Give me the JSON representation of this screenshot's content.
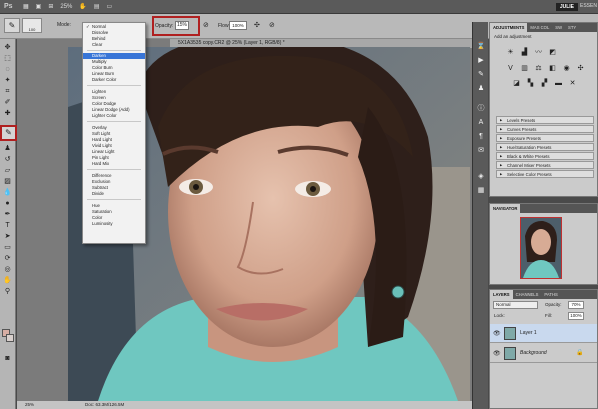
{
  "appbar": {
    "app_icon": "Ps",
    "zoom": "25%",
    "user": "JULIE",
    "workspace": "ESSEN"
  },
  "options": {
    "brush_size": "100",
    "mode_label": "Mode:",
    "opacity_label": "Opacity:",
    "opacity_value": "15%",
    "flow_label": "Flow:",
    "flow_value": "100%"
  },
  "document": {
    "tab_title": "5X1A3535 copy.CR2 @ 25% (Layer 1, RGB/8) *",
    "status_zoom": "25%",
    "status_doc": "Doc: 63.3M/126.5M"
  },
  "blend_menu": {
    "checked": "Normal",
    "highlighted": "Darken",
    "groups": [
      [
        "Normal",
        "Dissolve",
        "Behind",
        "Clear"
      ],
      [
        "Darken",
        "Multiply",
        "Color Burn",
        "Linear Burn",
        "Darker Color"
      ],
      [
        "Lighten",
        "Screen",
        "Color Dodge",
        "Linear Dodge (Add)",
        "Lighter Color"
      ],
      [
        "Overlay",
        "Soft Light",
        "Hard Light",
        "Vivid Light",
        "Linear Light",
        "Pin Light",
        "Hard Mix"
      ],
      [
        "Difference",
        "Exclusion",
        "Subtract",
        "Divide"
      ],
      [
        "Hue",
        "Saturation",
        "Color",
        "Luminosity"
      ]
    ]
  },
  "adjustments": {
    "tabs": [
      "ADJUSTMENTS",
      "MAS COL",
      "SW",
      "STY"
    ],
    "title": "Add an adjustment",
    "presets": [
      "Levels Presets",
      "Curves Presets",
      "Exposure Presets",
      "Hue/Saturation Presets",
      "Black & White Presets",
      "Channel Mixer Presets",
      "Selective Color Presets"
    ]
  },
  "navigator": {
    "tab": "NAVIGATOR"
  },
  "layers": {
    "tabs": [
      "LAYERS",
      "CHANNELS",
      "PATHS"
    ],
    "blend": "Normal",
    "opacity_label": "Opacity:",
    "opacity_value": "70%",
    "lock_label": "Lock:",
    "fill_label": "Fill:",
    "fill_value": "100%",
    "items": [
      {
        "name": "Layer 1"
      },
      {
        "name": "Background"
      }
    ]
  },
  "colors": {
    "highlight": "#3875d7",
    "callout": "#b02020"
  }
}
